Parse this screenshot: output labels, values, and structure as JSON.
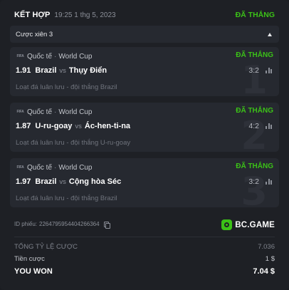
{
  "header": {
    "type": "KẾT HỢP",
    "date": "19:25 1 thg 5, 2023",
    "status": "ĐÃ THẮNG"
  },
  "parlay_bar": {
    "label": "Cược xiên 3",
    "expanded": true
  },
  "legs": [
    {
      "fifa_icon": "FIFA",
      "region": "Quốc tế",
      "competition": "World Cup",
      "status": "ĐÃ THẮNG",
      "odds": "1.91",
      "home": "Brazil",
      "vs": "vs",
      "away": "Thụy Điển",
      "score": "3:2",
      "market": "Loạt đá luân lưu - đội thắng Brazil",
      "index": "1"
    },
    {
      "fifa_icon": "FIFA",
      "region": "Quốc tế",
      "competition": "World Cup",
      "status": "ĐÃ THẮNG",
      "odds": "1.87",
      "home": "U-ru-goay",
      "vs": "vs",
      "away": "Ác-hen-ti-na",
      "score": "4:2",
      "market": "Loạt đá luân lưu - đội thắng U-ru-goay",
      "index": "2"
    },
    {
      "fifa_icon": "FIFA",
      "region": "Quốc tế",
      "competition": "World Cup",
      "status": "ĐÃ THẮNG",
      "odds": "1.97",
      "home": "Brazil",
      "vs": "vs",
      "away": "Cộng hòa Séc",
      "score": "3:2",
      "market": "Loạt đá luân lưu - đội thắng Brazil",
      "index": "3"
    }
  ],
  "footer": {
    "id_label": "ID phiếu:",
    "id_value": "2264795954404266364",
    "brand": "BC.GAME"
  },
  "summary": {
    "total_odds_label": "TỔNG TỶ LỆ CƯỢC",
    "total_odds_value": "7.036",
    "stake_label": "Tiền cược",
    "stake_value": "1 $",
    "won_label": "YOU WON",
    "won_value": "7.04 $"
  },
  "colors": {
    "win_green": "#3bc117",
    "background": "#1e2025",
    "card": "#262930"
  }
}
